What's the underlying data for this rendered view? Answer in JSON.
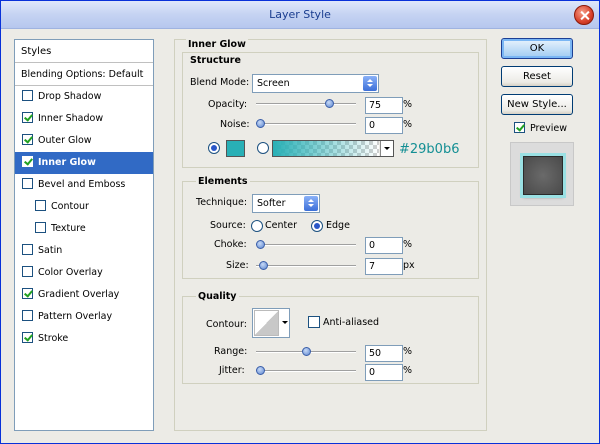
{
  "window": {
    "title": "Layer Style"
  },
  "styles_list": {
    "header": "Styles",
    "items": [
      {
        "label": "Blending Options: Default",
        "type": "plain"
      },
      {
        "label": "Drop Shadow",
        "checked": false
      },
      {
        "label": "Inner Shadow",
        "checked": true
      },
      {
        "label": "Outer Glow",
        "checked": true
      },
      {
        "label": "Inner Glow",
        "checked": true,
        "selected": true
      },
      {
        "label": "Bevel and Emboss",
        "checked": false
      },
      {
        "label": "Contour",
        "checked": false,
        "sub": true
      },
      {
        "label": "Texture",
        "checked": false,
        "sub": true
      },
      {
        "label": "Satin",
        "checked": false
      },
      {
        "label": "Color Overlay",
        "checked": false
      },
      {
        "label": "Gradient Overlay",
        "checked": true
      },
      {
        "label": "Pattern Overlay",
        "checked": false
      },
      {
        "label": "Stroke",
        "checked": true
      }
    ]
  },
  "inner_glow": {
    "title": "Inner Glow",
    "structure": {
      "title": "Structure",
      "blend_mode_label": "Blend Mode:",
      "blend_mode_value": "Screen",
      "opacity_label": "Opacity:",
      "opacity_value": "75",
      "opacity_unit": "%",
      "opacity_fraction": 0.75,
      "noise_label": "Noise:",
      "noise_value": "0",
      "noise_unit": "%",
      "noise_fraction": 0,
      "color_hex": "#29b0b6",
      "color_mode": "solid"
    },
    "elements": {
      "title": "Elements",
      "technique_label": "Technique:",
      "technique_value": "Softer",
      "source_label": "Source:",
      "source_center": "Center",
      "source_edge": "Edge",
      "source_selected": "Edge",
      "choke_label": "Choke:",
      "choke_value": "0",
      "choke_unit": "%",
      "choke_fraction": 0,
      "size_label": "Size:",
      "size_value": "7",
      "size_unit": "px",
      "size_fraction": 0.03
    },
    "quality": {
      "title": "Quality",
      "contour_label": "Contour:",
      "anti_aliased_label": "Anti-aliased",
      "anti_aliased_checked": false,
      "range_label": "Range:",
      "range_value": "50",
      "range_unit": "%",
      "range_fraction": 0.5,
      "jitter_label": "Jitter:",
      "jitter_value": "0",
      "jitter_unit": "%",
      "jitter_fraction": 0
    }
  },
  "buttons": {
    "ok": "OK",
    "reset": "Reset",
    "new_style": "New Style..."
  },
  "preview": {
    "label": "Preview",
    "checked": true
  },
  "colors": {
    "glow": "#29b0b6",
    "selection": "#316ac5"
  }
}
